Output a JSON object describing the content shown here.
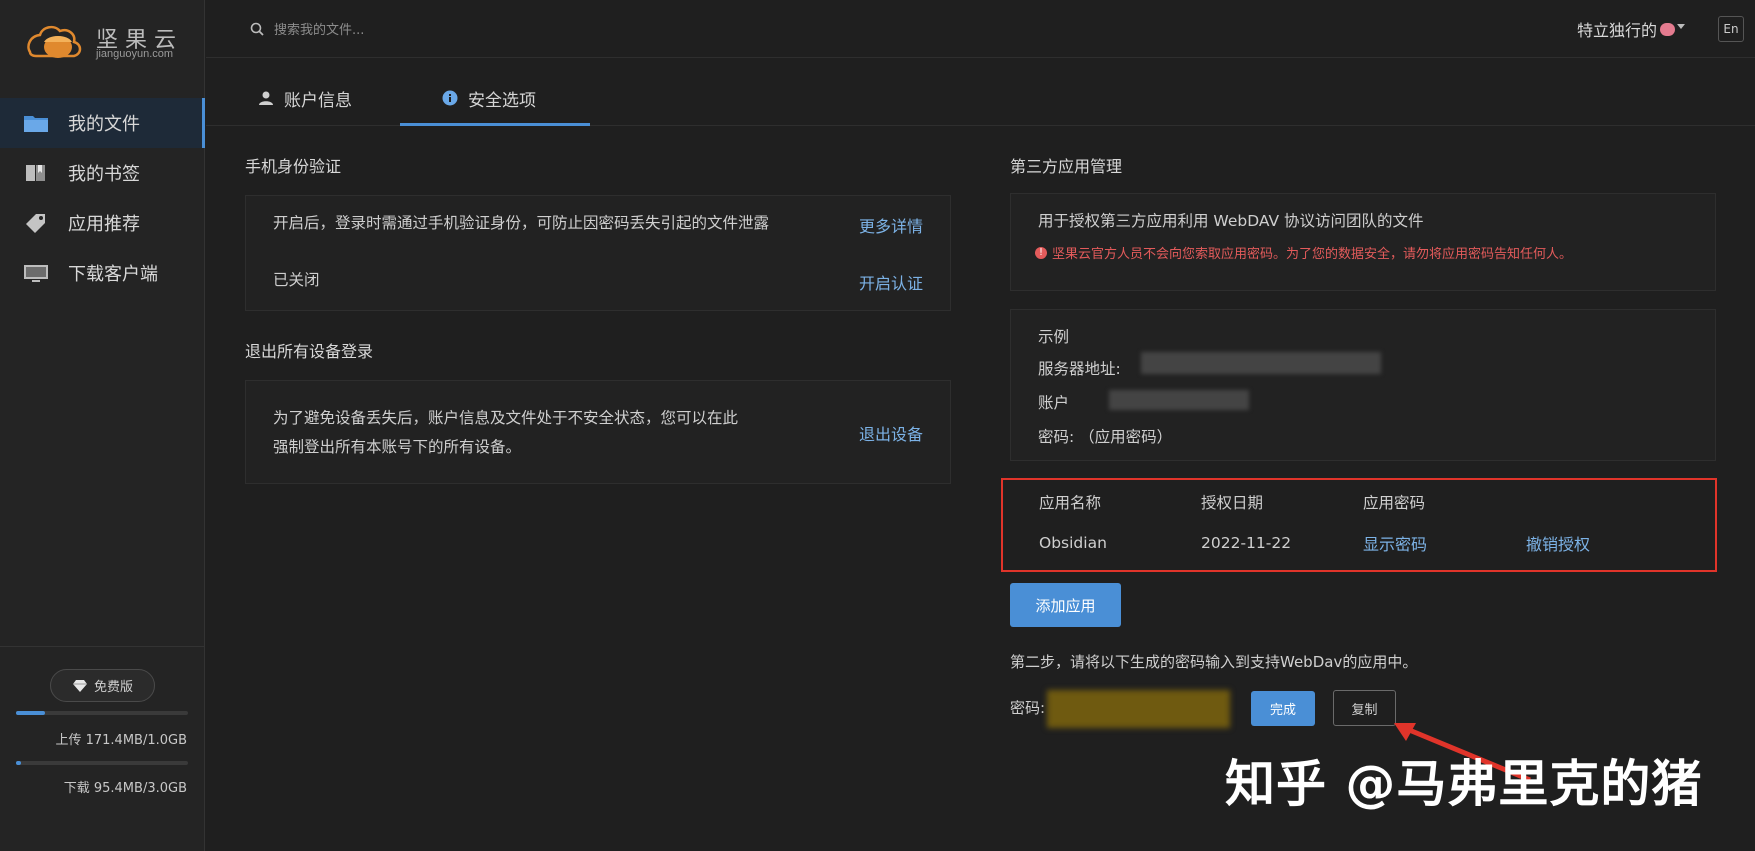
{
  "app": {
    "logo_text": "坚果云",
    "logo_sub": "jianguoyun.com"
  },
  "sidebar": {
    "items": [
      {
        "label": "我的文件",
        "icon": "folder-icon"
      },
      {
        "label": "我的书签",
        "icon": "bookmark-icon"
      },
      {
        "label": "应用推荐",
        "icon": "tag-icon"
      },
      {
        "label": "下载客户端",
        "icon": "monitor-icon"
      }
    ],
    "plan_label": "免费版",
    "upload": {
      "label": "上传 171.4MB/1.0GB",
      "fraction": 0.167
    },
    "download": {
      "label": "下载 95.4MB/3.0GB",
      "fraction": 0.031
    }
  },
  "header": {
    "search_placeholder": "搜索我的文件...",
    "username": "特立独行的",
    "lang_button": "En"
  },
  "tabs": [
    {
      "label": "账户信息",
      "icon": "user-icon"
    },
    {
      "label": "安全选项",
      "icon": "info-icon"
    }
  ],
  "phone_auth": {
    "title": "手机身份验证",
    "description": "开启后，登录时需通过手机验证身份，可防止因密码丢失引起的文件泄露",
    "more_link": "更多详情",
    "status": "已关闭",
    "enable_link": "开启认证"
  },
  "logout_devices": {
    "title": "退出所有设备登录",
    "description_line1": "为了避免设备丢失后，账户信息及文件处于不安全状态，您可以在此",
    "description_line2": "强制登出所有本账号下的所有设备。",
    "logout_link": "退出设备"
  },
  "third_party": {
    "title": "第三方应用管理",
    "description": "用于授权第三方应用利用 WebDAV 协议访问团队的文件",
    "warning": "坚果云官方人员不会向您索取应用密码。为了您的数据安全，请勿将应用密码告知任何人。",
    "example_title": "示例",
    "server_label": "服务器地址:",
    "account_label": "账户",
    "password_label": "密码: （应用密码）",
    "table": {
      "headers": [
        "应用名称",
        "授权日期",
        "应用密码"
      ],
      "rows": [
        {
          "name": "Obsidian",
          "date": "2022-11-22",
          "show_password": "显示密码",
          "revoke": "撤销授权"
        }
      ]
    },
    "add_button": "添加应用",
    "step_two": "第二步，请将以下生成的密码输入到支持WebDav的应用中。",
    "password_field_label": "密码:",
    "done_button": "完成",
    "copy_button": "复制"
  },
  "watermark": "知乎 @马弗里克的猪",
  "colors": {
    "accent": "#4a8fd6",
    "warning": "#e35b5b",
    "highlight_box": "#e0342a",
    "arrow": "#e0342a"
  }
}
